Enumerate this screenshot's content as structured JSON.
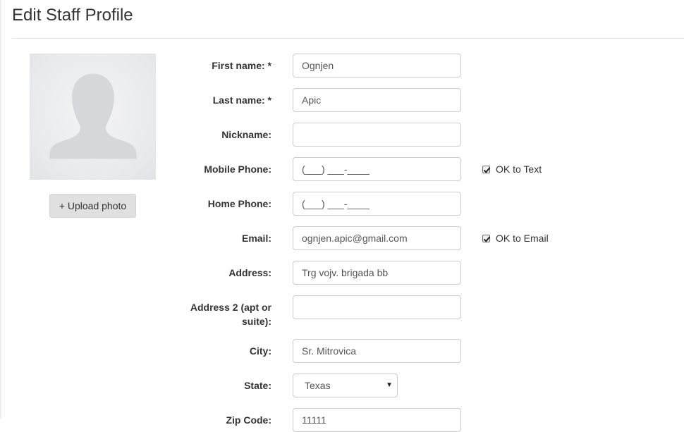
{
  "page": {
    "title": "Edit Staff Profile"
  },
  "photo": {
    "upload_label": "+ Upload photo",
    "avatar_icon": "person-silhouette-icon"
  },
  "fields": {
    "first_name": {
      "label": "First name: *",
      "value": "Ognjen"
    },
    "last_name": {
      "label": "Last name: *",
      "value": "Apic"
    },
    "nickname": {
      "label": "Nickname:",
      "value": ""
    },
    "mobile_phone": {
      "label": "Mobile Phone:",
      "placeholder": "(___) ___-____"
    },
    "home_phone": {
      "label": "Home Phone:",
      "placeholder": "(___) ___-____"
    },
    "email": {
      "label": "Email:",
      "value": "ognjen.apic@gmail.com"
    },
    "address": {
      "label": "Address:",
      "value": "Trg vojv. brigada bb"
    },
    "address2": {
      "label_line1": "Address 2 (apt or",
      "label_line2": "suite):",
      "value": ""
    },
    "city": {
      "label": "City:",
      "value": "Sr. Mitrovica"
    },
    "state": {
      "label": "State:",
      "value": "Texas"
    },
    "zip": {
      "label": "Zip Code:",
      "value": "11111"
    }
  },
  "checks": {
    "ok_to_text": {
      "label": "OK to Text",
      "checked": true
    },
    "ok_to_email": {
      "label": "OK to Email",
      "checked": true
    }
  }
}
